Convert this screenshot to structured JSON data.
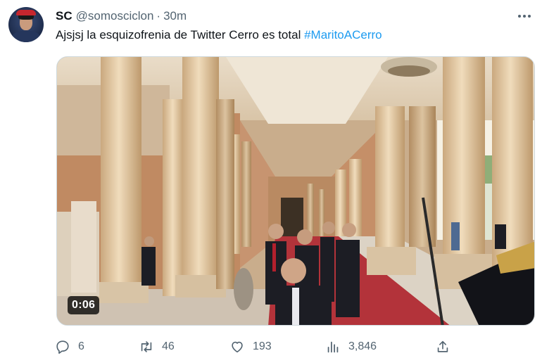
{
  "tweet": {
    "author_name": "SC",
    "author_handle": "@somosciclon",
    "separator": "·",
    "time": "30m",
    "text": "Ajsjsj la esquizofrenia de Twitter Cerro es total",
    "hashtag": "#MaritoACerro"
  },
  "media": {
    "duration": "0:06"
  },
  "actions": {
    "replies": "6",
    "retweets": "46",
    "likes": "193",
    "views": "3,846"
  },
  "icons": {
    "more": "more-horizontal-icon",
    "reply": "reply-icon",
    "retweet": "retweet-icon",
    "like": "heart-icon",
    "views": "views-bar-chart-icon",
    "share": "share-icon"
  },
  "colors": {
    "hashtag": "#1d9bf0",
    "secondary_text": "#536471",
    "primary_text": "#0f1419"
  }
}
